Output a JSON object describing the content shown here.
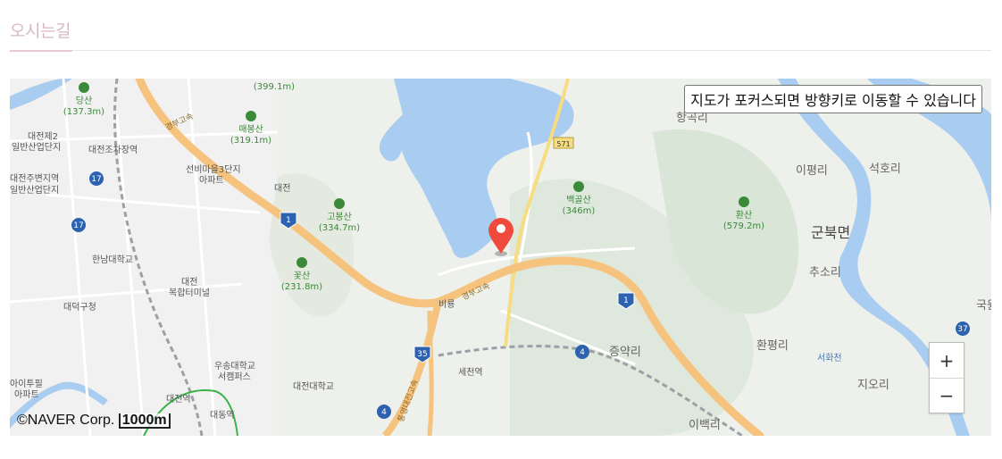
{
  "page": {
    "title": "오시는길"
  },
  "map": {
    "focus_hint": "지도가 포커스되면 방향키로 이동할 수 있습니다",
    "zoom_in": "+",
    "zoom_out": "−",
    "attribution": "NAVER Corp.",
    "scale": "1000m",
    "marker_icon": "map-pin-icon",
    "colors": {
      "water": "#a8cdf0",
      "highway": "#f6c37e",
      "mountain_label": "#3a8a3a",
      "marker": "#f04a3c"
    },
    "labels": {
      "dangsan": "당산",
      "dangsan_h": "(137.3m)",
      "h399": "(399.1m)",
      "daejeon2": "대전제2",
      "daejeon2b": "일반산업단지",
      "daejeon_yard": "대전조차장역",
      "maebongsan": "매봉산",
      "maebongsan_h": "(319.1m)",
      "seonbi": "선비마을3단지",
      "seonbi_b": "아파트",
      "ic_daejeon": "대전",
      "gyeongbu1": "경부고속",
      "gyeongbu2": "경부고속",
      "daejeon_jubyeon": "대전주변지역",
      "daejeon_jubyeon_b": "일반산업단지",
      "gobongsan": "고봉산",
      "gobongsan_h": "(334.7m)",
      "hannam": "한남대학교",
      "terminal": "대전",
      "terminal_b": "복합터미널",
      "kkotsan": "꽃산",
      "kkotsan_h": "(231.8m)",
      "daedeok": "대덕구청",
      "woosong": "우송대학교",
      "woosong_b": "서캠퍼스",
      "daejeon_univ": "대전대학교",
      "daejeon_st": "대전역",
      "daedong": "대동역",
      "aitopia": "아이투필",
      "aitopia_b": "아파트",
      "sekcheon": "세천역",
      "biryong": "비룡",
      "tongyeong": "통영대전고속",
      "r571": "571",
      "baekgolsan": "백골산",
      "baekgolsan_h": "(346m)",
      "hanggokri": "항곡리",
      "ipyeongri": "이평리",
      "seokhori": "석호리",
      "hwansan": "환산",
      "hwansan_h": "(579.2m)",
      "gunbukmyeon": "군북면",
      "chusori": "추소리",
      "jeungyakri": "증약리",
      "hwanpyeongri": "환평리",
      "seohwacheon": "서화천",
      "jiori": "지오리",
      "ibaekri": "이백리",
      "r37": "37",
      "r17a": "17",
      "r17b": "17",
      "r35": "35",
      "r1a": "1",
      "r1b": "1",
      "r4a": "4",
      "r4b": "4",
      "guk": "국원"
    }
  }
}
